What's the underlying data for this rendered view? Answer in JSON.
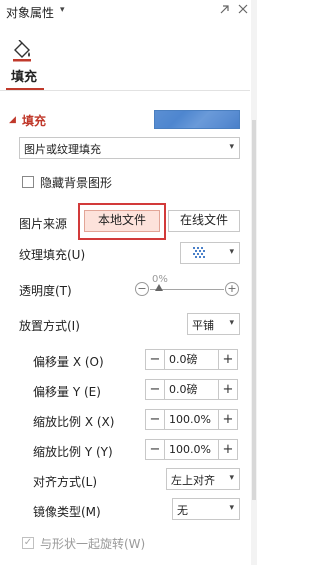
{
  "panel": {
    "title": "对象属性",
    "title_caret": "▾"
  },
  "tab": {
    "label": "填充"
  },
  "fill_section": {
    "title": "填充",
    "collapse_icon": "triangle-down-icon",
    "swatch_color": "#5b8fd3"
  },
  "fill_type": {
    "value": "图片或纹理填充"
  },
  "hide_background": {
    "label": "隐藏背景图形"
  },
  "picture_source": {
    "label": "图片来源",
    "local_button": "本地文件",
    "online_button": "在线文件"
  },
  "texture_fill": {
    "label": "纹理填充(U)"
  },
  "transparency": {
    "label": "透明度(T)",
    "value": "0%",
    "value_fraction": 0
  },
  "placement": {
    "label": "放置方式(I)",
    "value": "平铺"
  },
  "offset_x": {
    "label": "偏移量 X (O)",
    "value": "0.0磅"
  },
  "offset_y": {
    "label": "偏移量 Y (E)",
    "value": "0.0磅"
  },
  "scale_x": {
    "label": "缩放比例 X (X)",
    "value": "100.0%"
  },
  "scale_y": {
    "label": "缩放比例 Y (Y)",
    "value": "100.0%"
  },
  "alignment": {
    "label": "对齐方式(L)",
    "value": "左上对齐"
  },
  "mirror": {
    "label": "镜像类型(M)",
    "value": "无"
  },
  "rotate_with_shape": {
    "label": "与形状一起旋转(W)",
    "checked": true
  },
  "colors": {
    "accent": "#c0392b",
    "highlight": "#d23a3a",
    "active_button_bg": "#fde2db"
  }
}
